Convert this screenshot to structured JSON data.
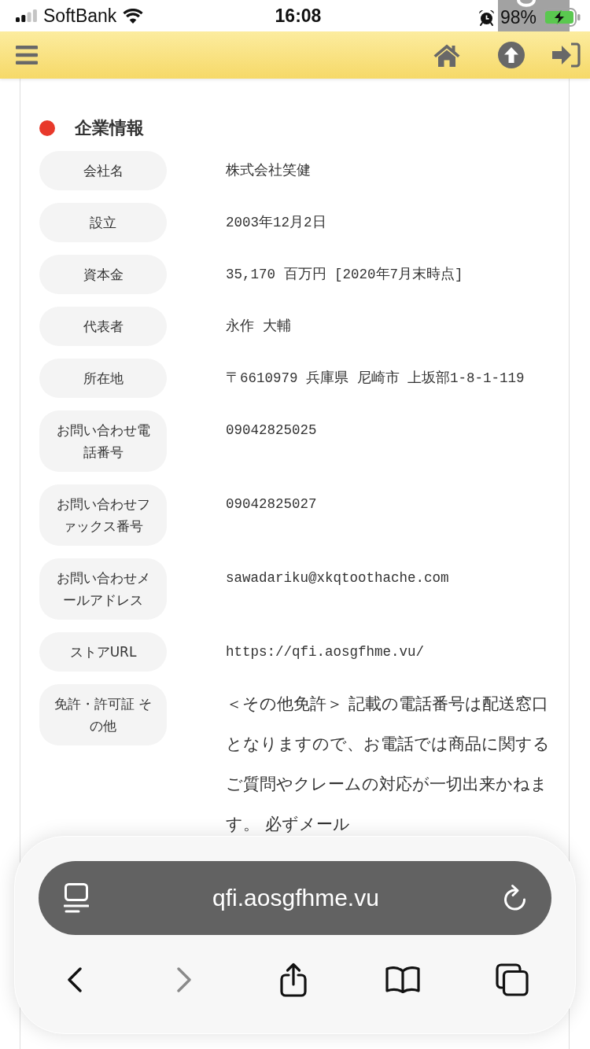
{
  "status_bar": {
    "carrier": "SoftBank",
    "time": "16:08",
    "battery": "98%",
    "charging": true
  },
  "section": {
    "title": "企業情報",
    "rows": [
      {
        "label": "会社名",
        "value": "株式会社笑健",
        "kind": "field"
      },
      {
        "label": "設立",
        "value": "2003年12月2日",
        "kind": "field"
      },
      {
        "label": "資本金",
        "value": "35,170 百万円 [2020年7月末時点]",
        "kind": "field"
      },
      {
        "label": "代表者",
        "value": "永作 大輔",
        "kind": "field"
      },
      {
        "label": "所在地",
        "value": "〒6610979 兵庫県 尼崎市 上坂部1-8-1-119",
        "kind": "field"
      },
      {
        "label": "お問い合わせ電話番号",
        "value": "09042825025",
        "kind": "field"
      },
      {
        "label": "お問い合わせファックス番号",
        "value": "09042825027",
        "kind": "field"
      },
      {
        "label": "お問い合わせメールアドレス",
        "value": "sawadariku@xkqtoothache.com",
        "kind": "field"
      },
      {
        "label": "ストアURL",
        "value": "https://qfi.aosgfhme.vu/",
        "kind": "field"
      },
      {
        "label": "免許・許可証 その他",
        "value": "＜その他免許＞ 記載の電話番号は配送窓口となりますので、お電話では商品に関するご質問やクレームの対応が一切出来かねます。 必ずメール",
        "kind": "note"
      }
    ]
  },
  "browser": {
    "url": "qfi.aosgfhme.vu",
    "toolbar": [
      {
        "kind": "back",
        "disabled": false
      },
      {
        "kind": "forward",
        "disabled": true
      },
      {
        "kind": "share",
        "disabled": false
      },
      {
        "kind": "bookmarks",
        "disabled": false
      },
      {
        "kind": "tabs",
        "disabled": false
      }
    ]
  }
}
